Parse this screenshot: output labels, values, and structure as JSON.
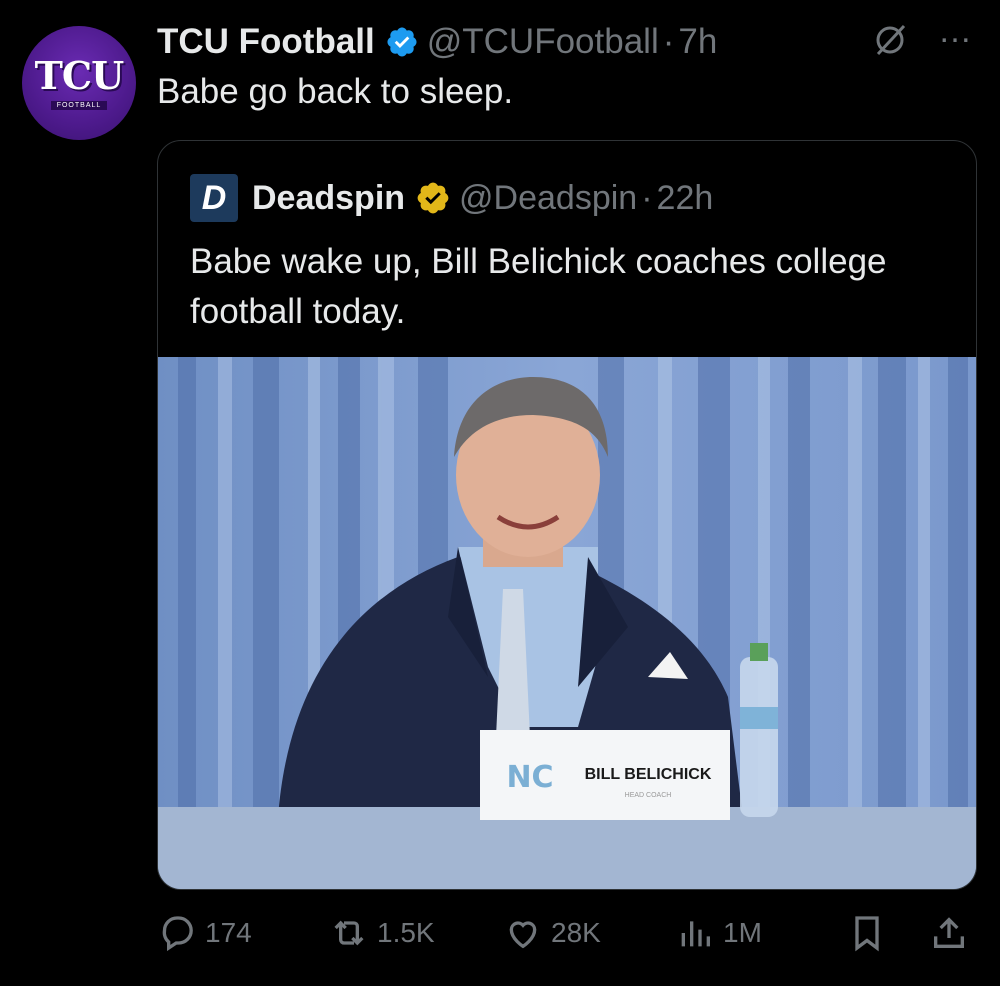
{
  "tweet": {
    "display_name": "TCU Football",
    "handle": "@TCUFootball",
    "separator": "·",
    "time": "7h",
    "text": "Babe go back to sleep.",
    "avatar_text": "TCU",
    "avatar_sub": "FOOTBALL",
    "avatar_icon": "tcu-football-logo",
    "verified_icon": "blue-verified-badge",
    "accent_color": "#1d9bf0"
  },
  "quoted": {
    "display_name": "Deadspin",
    "handle": "@Deadspin",
    "separator": "·",
    "time": "22h",
    "text": "Babe wake up, Bill Belichick coaches college football today.",
    "avatar_letter": "D",
    "verified_icon": "gold-verified-badge",
    "badge_color": "#e2b719",
    "media": {
      "nameplate_text": "BILL BELICHICK",
      "nameplate_subtext": "HEAD COACH"
    }
  },
  "actions": {
    "replies": "174",
    "reposts": "1.5K",
    "likes": "28K",
    "views": "1M"
  },
  "icons": [
    "grok-icon",
    "more-icon",
    "reply-icon",
    "repost-icon",
    "like-icon",
    "views-icon",
    "bookmark-icon",
    "share-icon"
  ]
}
